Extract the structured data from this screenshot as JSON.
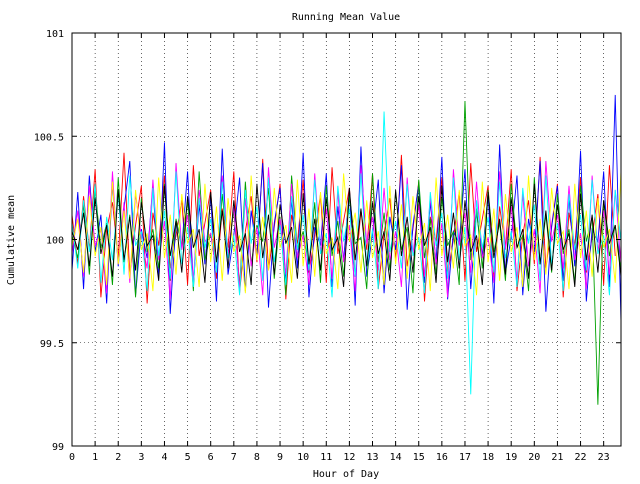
{
  "chart_data": {
    "type": "line",
    "title": "Running Mean Value",
    "xlabel": "Hour of Day",
    "ylabel": "Cumulative mean",
    "xlim": [
      0,
      23.75
    ],
    "ylim": [
      99,
      101
    ],
    "xticks": [
      0,
      1,
      2,
      3,
      4,
      5,
      6,
      7,
      8,
      9,
      10,
      11,
      12,
      13,
      14,
      15,
      16,
      17,
      18,
      19,
      20,
      21,
      22,
      23
    ],
    "xtick_labels": [
      "0",
      "1",
      "2",
      "3",
      "4",
      "5",
      "6",
      "7",
      "8",
      "9",
      "10",
      "11",
      "12",
      "13",
      "14",
      "15",
      "16",
      "17",
      "18",
      "19",
      "20",
      "21",
      "22",
      "23"
    ],
    "yticks": [
      99,
      99.5,
      100,
      100.5,
      101
    ],
    "ytick_labels": [
      "99",
      "99.5",
      "100",
      "100.5",
      "101"
    ],
    "grid": "dotted",
    "x_step_hours": 0.25,
    "series_colors": [
      "#ff0000",
      "#0000ff",
      "#00a000",
      "#ff00ff",
      "#00ffff",
      "#ffff00",
      "#000000"
    ],
    "series": [
      {
        "color": "#ff0000",
        "values": [
          100.12,
          99.88,
          100.21,
          99.95,
          100.34,
          99.72,
          100.05,
          100.18,
          99.91,
          100.42,
          99.83,
          100.07,
          100.26,
          99.69,
          100.13,
          99.97,
          100.31,
          99.86,
          100.02,
          100.19,
          99.78,
          100.36,
          99.92,
          100.08,
          100.24,
          99.81,
          100.15,
          99.96,
          100.33,
          99.74,
          100.04,
          100.21,
          99.89,
          100.39,
          99.85,
          100.06,
          100.27,
          99.71,
          100.12,
          99.98,
          100.29,
          99.84,
          100.01,
          100.22,
          99.79,
          100.35,
          99.93,
          100.09,
          100.25,
          99.82,
          100.14,
          99.95,
          100.32,
          99.76,
          100.03,
          100.2,
          99.9,
          100.41,
          99.87,
          100.05,
          100.28,
          99.7,
          100.11,
          99.99,
          100.3,
          99.83,
          100.0,
          100.23,
          99.8,
          100.37,
          99.94,
          100.1,
          100.26,
          99.81,
          100.16,
          99.96,
          100.34,
          99.75,
          100.02,
          100.19,
          99.88,
          100.4,
          99.86,
          100.07,
          100.27,
          99.72,
          100.13,
          99.97,
          100.3,
          99.84,
          100.01,
          100.22,
          99.78,
          100.36,
          99.92
        ]
      },
      {
        "color": "#0000ff",
        "values": [
          99.85,
          100.23,
          99.76,
          100.31,
          99.94,
          100.12,
          99.69,
          100.28,
          99.87,
          100.15,
          100.38,
          99.73,
          100.05,
          99.91,
          100.26,
          99.81,
          100.47,
          99.64,
          100.09,
          99.96,
          100.33,
          99.78,
          100.17,
          99.88,
          100.21,
          99.7,
          100.44,
          99.83,
          100.02,
          100.3,
          99.75,
          100.14,
          99.93,
          100.37,
          99.67,
          100.08,
          100.25,
          99.8,
          100.19,
          99.86,
          100.42,
          99.72,
          100.06,
          99.97,
          100.32,
          99.77,
          100.16,
          99.9,
          100.24,
          99.68,
          100.45,
          99.82,
          100.03,
          100.29,
          99.74,
          100.11,
          99.95,
          100.36,
          99.66,
          100.07,
          100.27,
          99.79,
          100.18,
          99.89,
          100.4,
          99.71,
          100.04,
          99.98,
          100.34,
          99.76,
          100.13,
          99.92,
          100.22,
          99.69,
          100.46,
          99.84,
          100.01,
          100.31,
          99.73,
          100.1,
          99.94,
          100.38,
          99.65,
          100.06,
          100.26,
          99.8,
          100.2,
          99.87,
          100.43,
          99.7,
          100.05,
          99.99,
          100.33,
          99.77,
          100.7,
          99.6
        ]
      },
      {
        "color": "#00a000",
        "values": [
          100.02,
          99.91,
          100.17,
          99.83,
          100.24,
          99.96,
          100.08,
          99.78,
          100.3,
          99.89,
          100.12,
          99.72,
          100.2,
          99.94,
          100.05,
          99.86,
          100.27,
          99.8,
          100.1,
          99.97,
          100.19,
          99.75,
          100.33,
          99.9,
          100.03,
          99.84,
          100.22,
          99.93,
          100.14,
          99.77,
          100.28,
          99.88,
          100.07,
          99.99,
          100.25,
          99.81,
          100.11,
          99.73,
          100.31,
          99.95,
          100.04,
          99.87,
          100.18,
          99.79,
          100.26,
          99.92,
          100.09,
          99.82,
          100.21,
          99.98,
          100.01,
          99.76,
          100.32,
          99.89,
          100.13,
          99.85,
          100.23,
          99.95,
          100.06,
          99.74,
          100.29,
          99.91,
          100.1,
          99.83,
          100.2,
          99.97,
          100.04,
          99.78,
          100.67,
          99.9,
          100.15,
          99.86,
          100.24,
          99.94,
          100.08,
          99.8,
          100.27,
          99.96,
          100.02,
          99.75,
          100.3,
          99.88,
          100.12,
          99.84,
          100.22,
          99.93,
          100.05,
          99.79,
          100.26,
          99.99,
          100.11,
          99.2,
          100.19,
          99.92,
          100.07,
          99.85
        ]
      },
      {
        "color": "#ff00ff",
        "values": [
          99.93,
          100.14,
          99.82,
          100.26,
          99.97,
          100.05,
          99.74,
          100.33,
          99.88,
          100.18,
          99.79,
          100.22,
          100.01,
          99.86,
          100.29,
          99.9,
          100.09,
          99.71,
          100.37,
          99.95,
          100.12,
          99.8,
          100.24,
          99.99,
          100.03,
          99.84,
          100.31,
          99.92,
          100.16,
          99.76,
          100.2,
          99.87,
          100.06,
          99.73,
          100.35,
          99.96,
          100.1,
          99.83,
          100.27,
          99.91,
          100.02,
          99.78,
          100.32,
          99.94,
          100.15,
          99.81,
          100.23,
          99.89,
          100.07,
          99.75,
          100.36,
          99.98,
          100.11,
          99.85,
          100.25,
          99.9,
          100.04,
          99.77,
          100.3,
          99.93,
          100.17,
          99.82,
          100.21,
          99.88,
          100.08,
          99.72,
          100.34,
          99.97,
          100.13,
          99.84,
          100.28,
          99.91,
          100.01,
          99.79,
          100.33,
          99.95,
          100.16,
          99.8,
          100.22,
          99.87,
          100.05,
          99.74,
          100.38,
          99.99,
          100.12,
          99.86,
          100.26,
          99.9,
          100.03,
          99.76,
          100.31,
          99.94,
          100.14,
          99.83,
          100.24,
          99.88
        ]
      },
      {
        "color": "#00ffff",
        "values": [
          100.08,
          99.86,
          100.19,
          99.94,
          100.27,
          99.79,
          100.11,
          99.9,
          100.22,
          99.83,
          100.31,
          99.97,
          100.04,
          99.75,
          100.25,
          99.92,
          100.14,
          99.81,
          100.33,
          99.88,
          100.06,
          99.77,
          100.2,
          99.96,
          100.1,
          99.84,
          100.28,
          99.91,
          100.02,
          99.73,
          100.24,
          99.98,
          100.16,
          99.8,
          100.3,
          99.89,
          100.07,
          99.78,
          100.21,
          99.95,
          100.12,
          99.85,
          100.29,
          99.93,
          100.03,
          99.72,
          100.26,
          99.99,
          100.15,
          99.82,
          100.32,
          99.87,
          100.05,
          99.76,
          100.62,
          99.94,
          100.09,
          99.86,
          100.27,
          99.92,
          100.01,
          99.74,
          100.23,
          99.97,
          100.13,
          99.81,
          100.3,
          99.9,
          100.06,
          99.25,
          100.19,
          99.96,
          100.11,
          99.84,
          100.28,
          99.91,
          100.04,
          99.77,
          100.25,
          99.98,
          100.17,
          99.8,
          100.31,
          99.88,
          100.08,
          99.75,
          100.22,
          99.95,
          100.12,
          99.85,
          100.29,
          99.93,
          100.02,
          99.73,
          100.24,
          99.99
        ]
      },
      {
        "color": "#ffff00",
        "values": [
          99.97,
          100.1,
          99.84,
          100.21,
          99.92,
          100.06,
          99.78,
          100.28,
          99.88,
          100.14,
          99.81,
          100.24,
          99.95,
          100.03,
          99.75,
          100.3,
          99.91,
          100.12,
          99.83,
          100.22,
          99.98,
          100.05,
          99.77,
          100.27,
          99.89,
          100.16,
          99.8,
          100.2,
          99.94,
          100.02,
          99.74,
          100.31,
          99.9,
          100.11,
          99.85,
          100.25,
          99.96,
          100.07,
          99.79,
          100.29,
          99.87,
          100.15,
          99.82,
          100.23,
          99.93,
          100.01,
          99.76,
          100.32,
          99.99,
          100.13,
          99.84,
          100.19,
          99.91,
          100.04,
          99.78,
          100.26,
          99.88,
          100.17,
          99.81,
          100.21,
          99.95,
          100.08,
          99.75,
          100.3,
          99.92,
          100.12,
          99.86,
          100.24,
          99.97,
          100.02,
          99.73,
          100.28,
          99.89,
          100.15,
          99.8,
          100.22,
          99.94,
          100.06,
          99.77,
          100.31,
          99.9,
          100.1,
          99.83,
          100.25,
          99.98,
          100.04,
          99.76,
          100.27,
          99.91,
          100.14,
          99.82,
          100.2,
          99.96,
          100.05,
          99.79,
          100.33
        ]
      },
      {
        "color": "#000000",
        "values": [
          100.04,
          99.95,
          100.13,
          99.87,
          100.2,
          99.93,
          100.07,
          99.82,
          100.24,
          99.9,
          100.11,
          99.85,
          100.18,
          99.97,
          100.02,
          99.8,
          100.26,
          99.92,
          100.09,
          99.84,
          100.21,
          99.96,
          100.05,
          99.79,
          100.23,
          99.89,
          100.14,
          99.86,
          100.19,
          99.94,
          100.03,
          99.78,
          100.27,
          99.91,
          100.12,
          99.83,
          100.17,
          99.98,
          100.06,
          99.81,
          100.22,
          99.88,
          100.1,
          99.85,
          100.2,
          99.95,
          100.01,
          99.77,
          100.25,
          99.9,
          100.15,
          99.87,
          100.18,
          99.93,
          100.04,
          99.8,
          100.24,
          99.92,
          100.11,
          99.84,
          100.21,
          99.97,
          100.06,
          99.79,
          100.26,
          99.89,
          100.13,
          99.86,
          100.19,
          99.94,
          100.02,
          99.78,
          100.23,
          99.91,
          100.1,
          99.83,
          100.2,
          99.96,
          100.05,
          99.81,
          100.27,
          99.88,
          100.14,
          99.85,
          100.17,
          99.95,
          100.03,
          99.77,
          100.22,
          99.9,
          100.12,
          99.84,
          100.19,
          99.98,
          100.07,
          99.82
        ]
      }
    ]
  }
}
